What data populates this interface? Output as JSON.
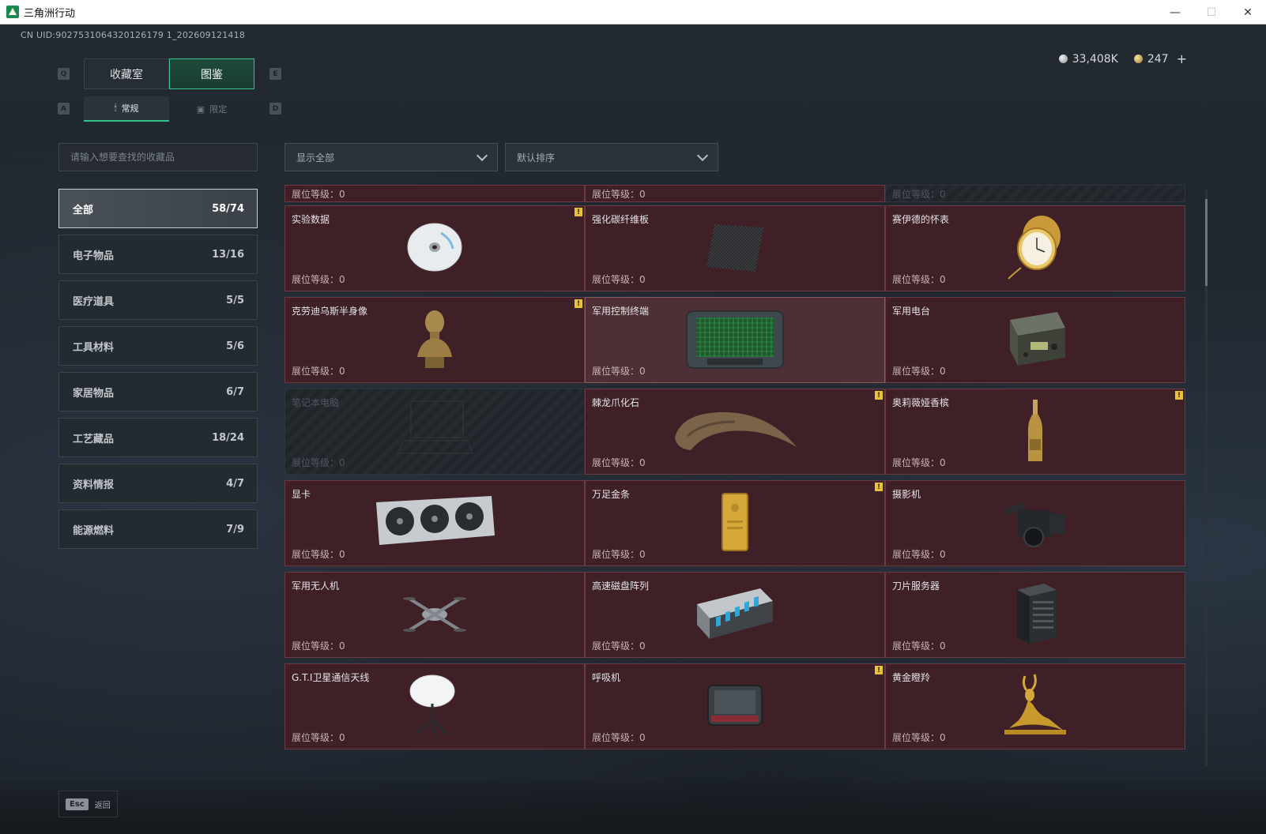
{
  "window": {
    "title": "三角洲行动",
    "minimize": "—",
    "maximize": "☐",
    "close": "✕"
  },
  "uid": "CN UID:9027531064320126179 1_202609121418",
  "currency": {
    "silver": "33,408K",
    "gold": "247",
    "add": "+"
  },
  "keys": {
    "prev_tab": "Q",
    "next_tab": "E",
    "prev_sub": "A",
    "next_sub": "D"
  },
  "main_tabs": [
    {
      "label": "收藏室",
      "active": false
    },
    {
      "label": "图鉴",
      "active": true
    }
  ],
  "sub_tabs": [
    {
      "label": "常规",
      "icon": "🕯",
      "active": true
    },
    {
      "label": "限定",
      "icon": "▣",
      "active": false
    }
  ],
  "search": {
    "placeholder": "请输入想要查找的收藏品"
  },
  "filters": {
    "show": "显示全部",
    "sort": "默认排序"
  },
  "categories": [
    {
      "label": "全部",
      "count": "58/74",
      "active": true
    },
    {
      "label": "电子物品",
      "count": "13/16"
    },
    {
      "label": "医疗道具",
      "count": "5/5"
    },
    {
      "label": "工具材料",
      "count": "5/6"
    },
    {
      "label": "家居物品",
      "count": "6/7"
    },
    {
      "label": "工艺藏品",
      "count": "18/24"
    },
    {
      "label": "资料情报",
      "count": "4/7"
    },
    {
      "label": "能源燃料",
      "count": "7/9"
    }
  ],
  "level_label": "展位等级：0",
  "items": [
    {
      "name": "",
      "level": "展位等级：0",
      "art": "none"
    },
    {
      "name": "",
      "level": "展位等级：0",
      "art": "none"
    },
    {
      "name": "",
      "level": "展位等级：0",
      "art": "none",
      "locked": true
    },
    {
      "name": "实验数据",
      "level": "展位等级：0",
      "art": "disc",
      "badge": true
    },
    {
      "name": "强化碳纤维板",
      "level": "展位等级：0",
      "art": "carbon"
    },
    {
      "name": "赛伊德的怀表",
      "level": "展位等级：0",
      "art": "watch"
    },
    {
      "name": "克劳迪乌斯半身像",
      "level": "展位等级：0",
      "art": "bust",
      "badge": true
    },
    {
      "name": "军用控制终端",
      "level": "展位等级：0",
      "art": "terminal",
      "hover": true
    },
    {
      "name": "军用电台",
      "level": "展位等级：0",
      "art": "radio"
    },
    {
      "name": "笔记本电脑",
      "level": "展位等级：0",
      "art": "laptop",
      "locked": true
    },
    {
      "name": "棘龙爪化石",
      "level": "展位等级：0",
      "art": "claw",
      "badge": true
    },
    {
      "name": "奥莉薇娅香槟",
      "level": "展位等级：0",
      "art": "bottle",
      "badge": true
    },
    {
      "name": "显卡",
      "level": "展位等级：0",
      "art": "gpu"
    },
    {
      "name": "万足金条",
      "level": "展位等级：0",
      "art": "goldbar",
      "badge": true
    },
    {
      "name": "摄影机",
      "level": "展位等级：0",
      "art": "camera"
    },
    {
      "name": "军用无人机",
      "level": "展位等级：0",
      "art": "drone"
    },
    {
      "name": "高速磁盘阵列",
      "level": "展位等级：0",
      "art": "raid"
    },
    {
      "name": "刀片服务器",
      "level": "展位等级：0",
      "art": "server"
    },
    {
      "name": "G.T.I卫星通信天线",
      "level": "展位等级：0",
      "art": "dish"
    },
    {
      "name": "呼吸机",
      "level": "展位等级：0",
      "art": "ventilator",
      "badge": true
    },
    {
      "name": "黄金瞪羚",
      "level": "展位等级：0",
      "art": "gazelle"
    }
  ],
  "badge_glyph": "!",
  "footer": {
    "esc_key": "Esc",
    "esc_label": "返回"
  }
}
